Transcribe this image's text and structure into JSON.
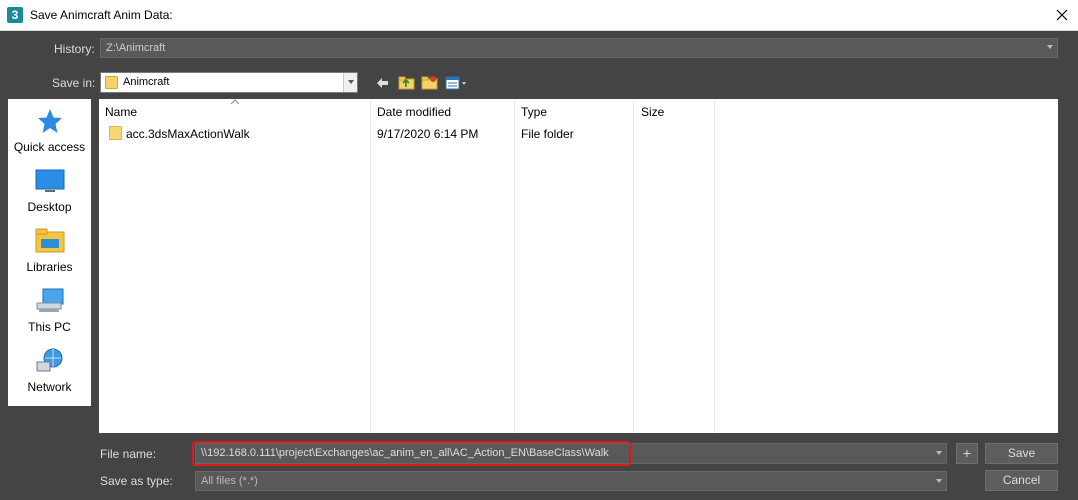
{
  "window": {
    "title": "Save Animcraft Anim Data:",
    "app_icon_label": "3"
  },
  "history": {
    "label": "History:",
    "value": "Z:\\Animcraft"
  },
  "save_in": {
    "label": "Save in:",
    "value": "Animcraft"
  },
  "places": [
    {
      "label": "Quick access",
      "icon": "star-icon"
    },
    {
      "label": "Desktop",
      "icon": "desktop-icon"
    },
    {
      "label": "Libraries",
      "icon": "libraries-icon"
    },
    {
      "label": "This PC",
      "icon": "computer-icon"
    },
    {
      "label": "Network",
      "icon": "network-icon"
    }
  ],
  "file_list": {
    "columns": [
      "Name",
      "Date modified",
      "Type",
      "Size"
    ],
    "rows": [
      {
        "name": "acc.3dsMaxActionWalk",
        "date_modified": "9/17/2020 6:14 PM",
        "type": "File folder",
        "size": ""
      }
    ]
  },
  "file_name": {
    "label": "File name:",
    "value": "\\\\192.168.0.111\\project\\Exchanges\\ac_anim_en_all\\AC_Action_EN\\BaseClass\\Walk"
  },
  "save_as_type": {
    "label": "Save as type:",
    "value": "All files (*.*)"
  },
  "buttons": {
    "plus": "+",
    "save": "Save",
    "cancel": "Cancel"
  },
  "colors": {
    "dialog_bg": "#444444",
    "highlight_border": "#e01818"
  }
}
